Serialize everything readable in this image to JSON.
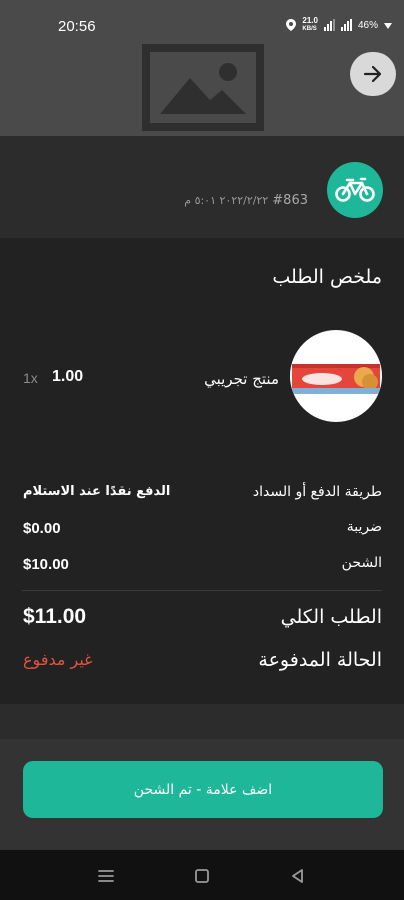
{
  "status_bar": {
    "time": "20:56",
    "network_speed": "21.0",
    "network_unit": "KB/S",
    "battery": "46%"
  },
  "order": {
    "number": "#863",
    "date": "٢٠٢٢/٢/٢٢ ٥:٠١ م"
  },
  "summary": {
    "title": "ملخص الطلب",
    "product": {
      "name": "منتج تجريبي",
      "price": "1.00",
      "qty": "1x"
    },
    "payment_method_label": "طريقة الدفع أو السداد",
    "payment_method_value": "الدفع نقدًا عند الاستلام",
    "tax_label": "ضريبة",
    "tax_value": "$0.00",
    "shipping_label": "الشحن",
    "shipping_value": "$10.00",
    "total_label": "الطلب الكلي",
    "total_value": "$11.00",
    "payment_status_label": "الحالة المدفوعة",
    "payment_status_value": "غير مدفوع"
  },
  "action_button_label": "اضف علامة - تم الشحن",
  "colors": {
    "accent": "#1fb799",
    "unpaid": "#e0543f",
    "background": "#222222"
  },
  "icons": [
    "image-placeholder-icon",
    "arrow-right-icon",
    "bicycle-icon",
    "menu-icon",
    "home-icon",
    "back-icon"
  ]
}
